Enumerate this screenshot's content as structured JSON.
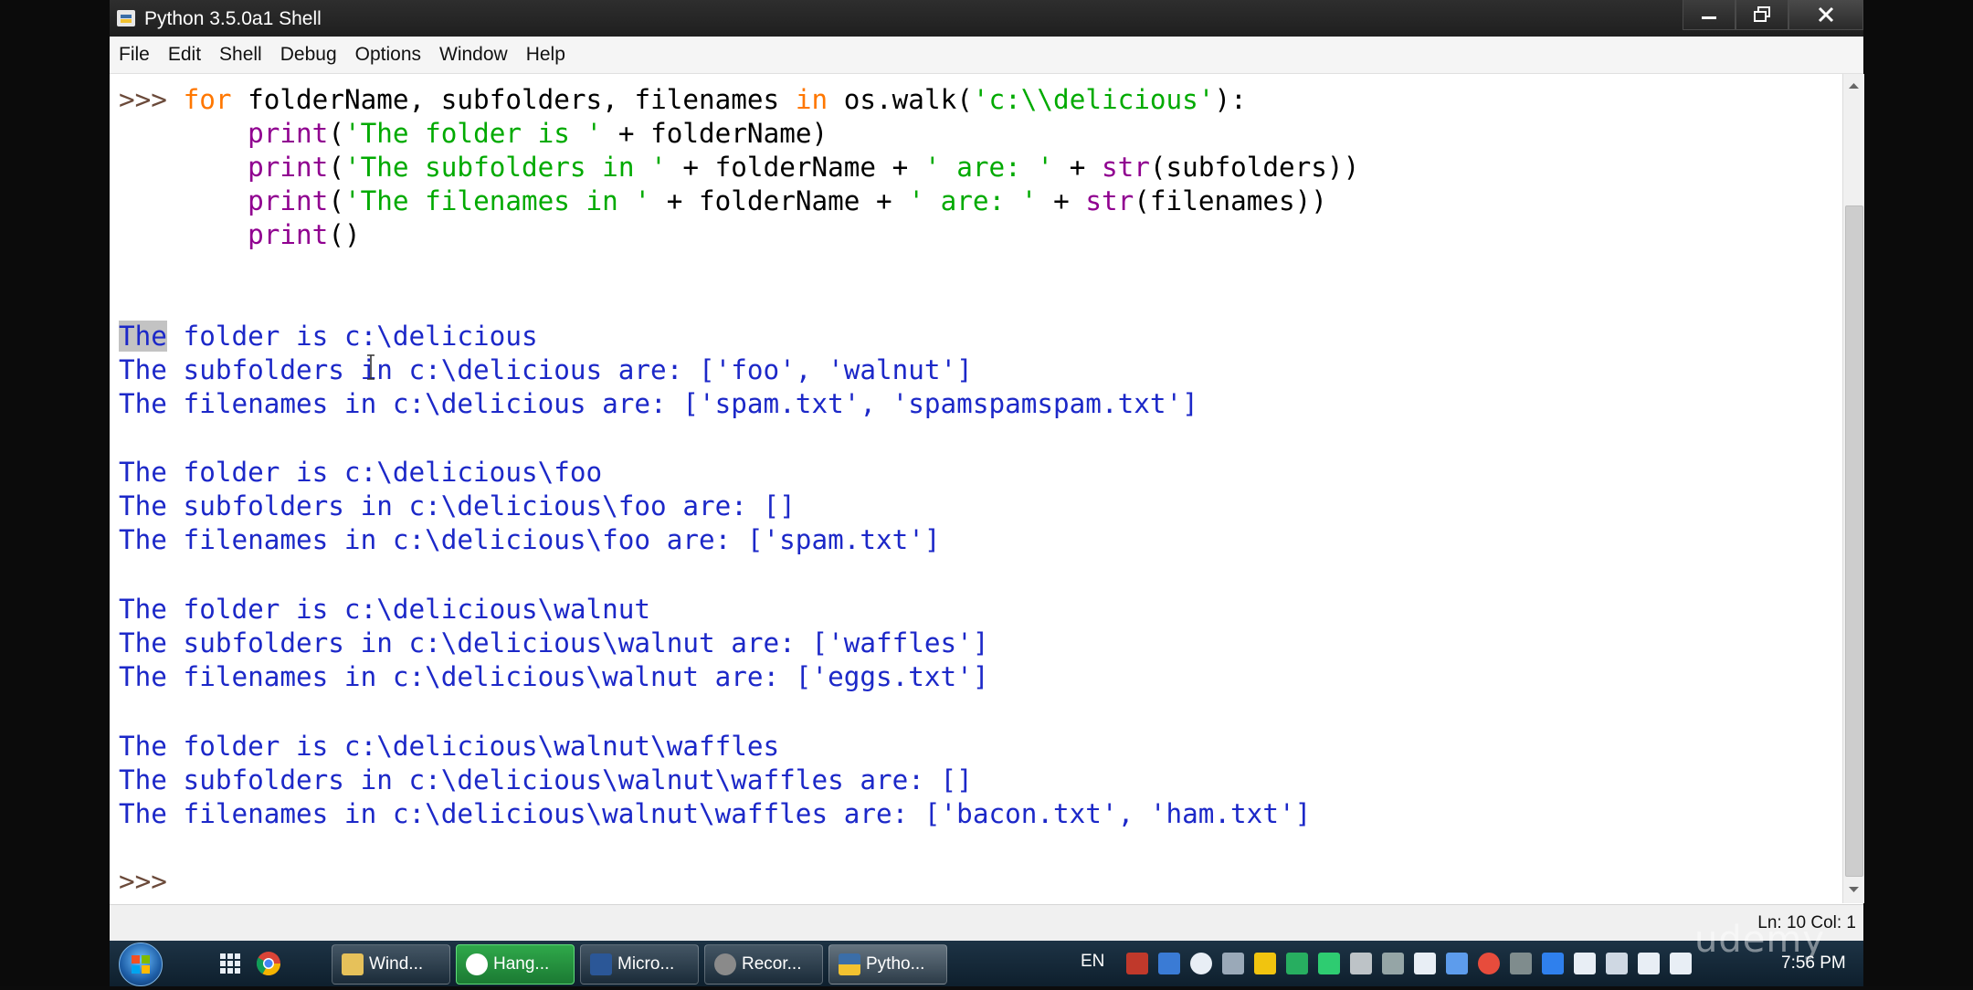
{
  "window": {
    "title": "Python 3.5.0a1 Shell",
    "minimize_label": "",
    "maximize_label": "",
    "close_label": ""
  },
  "menubar": [
    "File",
    "Edit",
    "Shell",
    "Debug",
    "Options",
    "Window",
    "Help"
  ],
  "editor": {
    "prompt": ">>> ",
    "code": {
      "l1": {
        "kw1": "for",
        "t1": " folderName, subfolders, filenames ",
        "kw2": "in",
        "t2": " os.walk(",
        "s1": "'c:\\\\delicious'",
        "t3": "):"
      },
      "l2": {
        "indent": "    ",
        "b": "print",
        "t1": "(",
        "s1": "'The folder is '",
        "t2": " + folderName)"
      },
      "l3": {
        "indent": "    ",
        "b": "print",
        "t1": "(",
        "s1": "'The subfolders in '",
        "t2": " + folderName + ",
        "s2": "' are: '",
        "t3": " + ",
        "b2": "str",
        "t4": "(subfolders))"
      },
      "l4": {
        "indent": "    ",
        "b": "print",
        "t1": "(",
        "s1": "'The filenames in '",
        "t2": " + folderName + ",
        "s2": "' are: '",
        "t3": " + ",
        "b2": "str",
        "t4": "(filenames))"
      },
      "l5": {
        "indent": "    ",
        "b": "print",
        "t1": "()"
      }
    },
    "output_first_selected": "The",
    "output_first_rest": " folder is c:\\delicious",
    "output": [
      "The subfolders in c:\\delicious are: ['foo', 'walnut']",
      "The filenames in c:\\delicious are: ['spam.txt', 'spamspamspam.txt']",
      "",
      "The folder is c:\\delicious\\foo",
      "The subfolders in c:\\delicious\\foo are: []",
      "The filenames in c:\\delicious\\foo are: ['spam.txt']",
      "",
      "The folder is c:\\delicious\\walnut",
      "The subfolders in c:\\delicious\\walnut are: ['waffles']",
      "The filenames in c:\\delicious\\walnut are: ['eggs.txt']",
      "",
      "The folder is c:\\delicious\\walnut\\waffles",
      "The subfolders in c:\\delicious\\walnut\\waffles are: []",
      "The filenames in c:\\delicious\\walnut\\waffles are: ['bacon.txt', 'ham.txt']"
    ],
    "final_prompt": ">>> "
  },
  "colors": {
    "keyword": "#ff7700",
    "string": "#00aa00",
    "builtin": "#900090",
    "output": "#1c28c8",
    "prompt": "#6b4a3a"
  },
  "status": {
    "position": "Ln: 10 Col: 1"
  },
  "taskbar": {
    "tasks": [
      {
        "label": "Wind...",
        "icon": "folder-icon"
      },
      {
        "label": "Hang...",
        "icon": "hangouts-icon"
      },
      {
        "label": "Micro...",
        "icon": "word-icon"
      },
      {
        "label": "Recor...",
        "icon": "recorder-icon"
      },
      {
        "label": "Pytho...",
        "icon": "python-icon"
      }
    ],
    "language": "EN",
    "clock": "7:56 PM"
  },
  "watermark": "udemy"
}
